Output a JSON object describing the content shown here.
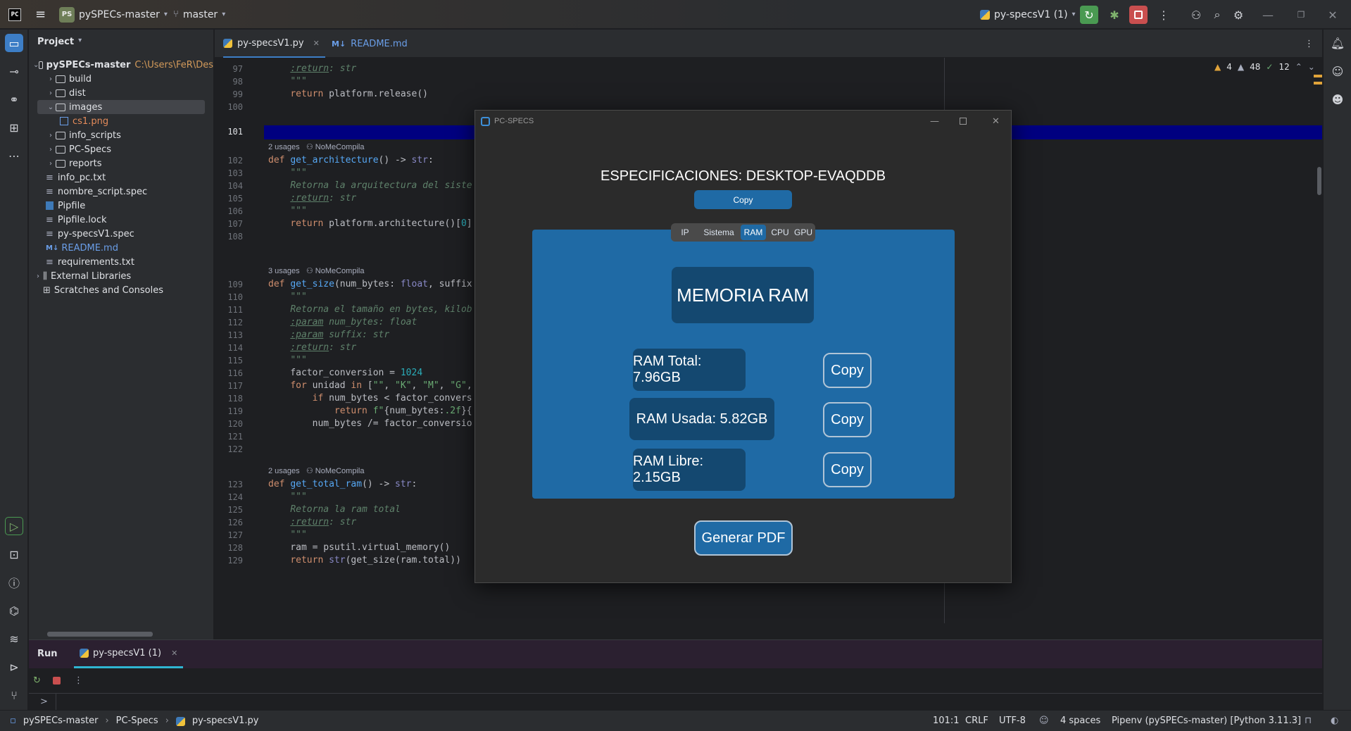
{
  "titlebar": {
    "project_badge": "PS",
    "project_name": "pySPECs-master",
    "branch": "master",
    "run_config": "py-specsV1 (1)"
  },
  "project_panel": {
    "title": "Project",
    "root_name": "pySPECs-master",
    "root_path": "C:\\Users\\FeR\\Des",
    "items": [
      {
        "label": "build",
        "kind": "folder"
      },
      {
        "label": "dist",
        "kind": "folder"
      },
      {
        "label": "images",
        "kind": "folder"
      },
      {
        "label": "cs1.png",
        "kind": "image"
      },
      {
        "label": "info_scripts",
        "kind": "folder"
      },
      {
        "label": "PC-Specs",
        "kind": "folder"
      },
      {
        "label": "reports",
        "kind": "folder"
      },
      {
        "label": "info_pc.txt",
        "kind": "file"
      },
      {
        "label": "nombre_script.spec",
        "kind": "file"
      },
      {
        "label": "Pipfile",
        "kind": "file"
      },
      {
        "label": "Pipfile.lock",
        "kind": "file"
      },
      {
        "label": "py-specsV1.spec",
        "kind": "file"
      },
      {
        "label": "README.md",
        "kind": "md"
      },
      {
        "label": "requirements.txt",
        "kind": "file"
      },
      {
        "label": "External Libraries",
        "kind": "lib"
      },
      {
        "label": "Scratches and Consoles",
        "kind": "scratch"
      }
    ]
  },
  "editor": {
    "tabs": [
      {
        "label": "py-specsV1.py"
      },
      {
        "label": "README.md"
      }
    ],
    "inspections": {
      "warnings": "4",
      "weak": "48",
      "typos": "12"
    },
    "line_numbers": [
      "97",
      "98",
      "99",
      "100",
      "101",
      "102",
      "103",
      "104",
      "105",
      "106",
      "107",
      "108",
      "109",
      "110",
      "111",
      "112",
      "113",
      "114",
      "115",
      "116",
      "117",
      "118",
      "119",
      "120",
      "121",
      "122",
      "123",
      "124",
      "125",
      "126",
      "127",
      "128",
      "129"
    ],
    "usages": [
      {
        "count": "2 usages",
        "author": "NoMeCompila"
      },
      {
        "count": "3 usages",
        "author": "NoMeCompila"
      },
      {
        "count": "2 usages",
        "author": "NoMeCompila"
      }
    ]
  },
  "app": {
    "window_title": "PC-SPECS",
    "heading": "ESPECIFICACIONES: DESKTOP-EVAQDDB",
    "copy_top": "Copy",
    "tabs": [
      "IP",
      "Sistema",
      "RAM",
      "CPU",
      "GPU"
    ],
    "active_tab": "RAM",
    "section_title": "MEMORIA RAM",
    "rows": [
      {
        "label": "RAM Total: 7.96GB",
        "copy": "Copy"
      },
      {
        "label": "RAM Usada: 5.82GB",
        "copy": "Copy"
      },
      {
        "label": "RAM Libre: 2.15GB",
        "copy": "Copy"
      }
    ],
    "pdf_button": "Generar PDF",
    "colors": {
      "accent": "#1f6aa5",
      "dark_label": "#144870",
      "bg": "#2b2b2b"
    }
  },
  "run_panel": {
    "title": "Run",
    "tab": "py-specsV1 (1)",
    "prompt": ">"
  },
  "statusbar": {
    "crumbs": [
      "pySPECs-master",
      "PC-Specs",
      "py-specsV1.py"
    ],
    "position": "101:1",
    "line_sep": "CRLF",
    "encoding": "UTF-8",
    "indent": "4 spaces",
    "interpreter": "Pipenv (pySPECs-master) [Python 3.11.3]"
  }
}
